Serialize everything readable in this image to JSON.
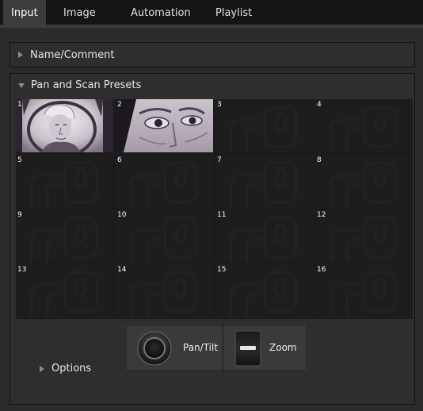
{
  "tabs": [
    {
      "label": "Input",
      "active": true
    },
    {
      "label": "Image",
      "active": false
    },
    {
      "label": "Automation",
      "active": false
    },
    {
      "label": "Playlist",
      "active": false
    }
  ],
  "name_comment": {
    "label": "Name/Comment",
    "expanded": false
  },
  "presets": {
    "label": "Pan and Scan Presets",
    "expanded": true,
    "cells": [
      {
        "num": "1",
        "content": "washington-portrait"
      },
      {
        "num": "2",
        "content": "washington-eyes"
      },
      {
        "num": "3",
        "content": "empty"
      },
      {
        "num": "4",
        "content": "empty"
      },
      {
        "num": "5",
        "content": "empty"
      },
      {
        "num": "6",
        "content": "empty"
      },
      {
        "num": "7",
        "content": "empty"
      },
      {
        "num": "8",
        "content": "empty"
      },
      {
        "num": "9",
        "content": "empty"
      },
      {
        "num": "10",
        "content": "empty"
      },
      {
        "num": "11",
        "content": "empty"
      },
      {
        "num": "12",
        "content": "empty"
      },
      {
        "num": "13",
        "content": "empty"
      },
      {
        "num": "14",
        "content": "empty"
      },
      {
        "num": "15",
        "content": "empty"
      },
      {
        "num": "16",
        "content": "empty"
      }
    ]
  },
  "controls": {
    "pan_tilt_label": "Pan/Tilt",
    "zoom_label": "Zoom"
  },
  "options": {
    "label": "Options",
    "expanded": false
  },
  "colors": {
    "tab_bar": "#141414",
    "panel": "#2e2e2e",
    "active_tab": "#3c3c3c"
  }
}
